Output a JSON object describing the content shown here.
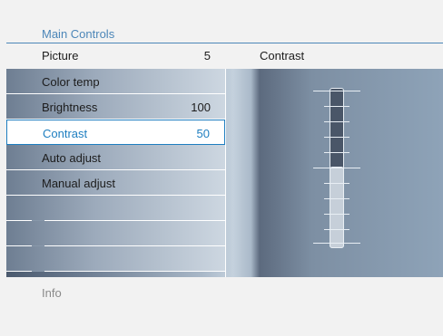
{
  "header": {
    "title": "Main Controls"
  },
  "top_row": {
    "label": "Picture",
    "value": "5",
    "right_label": "Contrast"
  },
  "menu": {
    "items": [
      {
        "label": "Color temp",
        "value": ""
      },
      {
        "label": "Brightness",
        "value": "100"
      },
      {
        "label": "Contrast",
        "value": "50",
        "selected": true
      },
      {
        "label": "Auto adjust",
        "value": ""
      },
      {
        "label": "Manual adjust",
        "value": ""
      },
      {
        "label": "",
        "value": ""
      },
      {
        "label": "",
        "value": ""
      },
      {
        "label": "",
        "value": ""
      }
    ]
  },
  "slider": {
    "name": "Contrast",
    "value": 50,
    "min": 0,
    "max": 100
  },
  "footer": {
    "info": "Info"
  },
  "colors": {
    "accent": "#1e7ec0",
    "header_accent": "#4c86b8"
  }
}
